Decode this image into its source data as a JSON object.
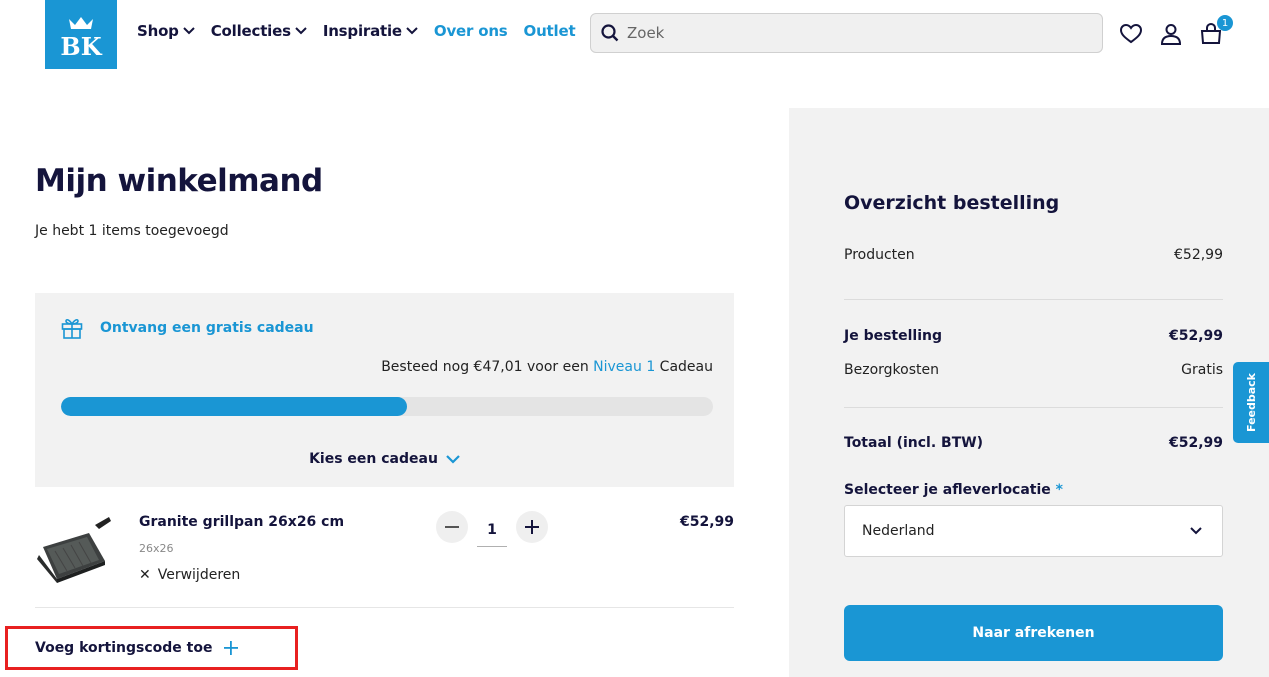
{
  "header": {
    "logo_text": "BK",
    "nav": [
      {
        "label": "Shop",
        "dropdown": true
      },
      {
        "label": "Collecties",
        "dropdown": true
      },
      {
        "label": "Inspiratie",
        "dropdown": true
      },
      {
        "label": "Over ons",
        "dropdown": false
      },
      {
        "label": "Outlet",
        "dropdown": false
      }
    ],
    "search_placeholder": "Zoek",
    "icons": [
      "heart-icon",
      "user-icon",
      "cart-icon"
    ],
    "cart_count": "1"
  },
  "cart": {
    "title": "Mijn winkelmand",
    "items_text": "Je hebt 1 items toegevoegd",
    "gift": {
      "title": "Ontvang een gratis cadeau",
      "text_before": "Besteed nog €47,01 voor een ",
      "level": "Niveau 1",
      "text_after": " Cadeau",
      "progress": 0.53,
      "choose_label": "Kies een cadeau"
    },
    "product": {
      "name": "Granite grillpan 26x26 cm",
      "variant": "26x26",
      "remove_label": "Verwijderen",
      "quantity": "1",
      "price": "€52,99"
    },
    "discount_label": "Voeg kortingscode toe"
  },
  "summary": {
    "title": "Overzicht bestelling",
    "products_label": "Producten",
    "products_value": "€52,99",
    "order_label": "Je bestelling",
    "order_value": "€52,99",
    "shipping_label": "Bezorgkosten",
    "shipping_value": "Gratis",
    "total_label": "Totaal (incl. BTW)",
    "total_value": "€52,99",
    "location_label": "Selecteer je afleverlocatie",
    "location_required": "*",
    "location_value": "Nederland",
    "checkout_label": "Naar afrekenen"
  },
  "feedback_label": "Feedback",
  "colors": {
    "accent": "#1a96d4",
    "navy": "#14143c",
    "panel": "#f2f2f2",
    "highlight": "#e82020"
  }
}
